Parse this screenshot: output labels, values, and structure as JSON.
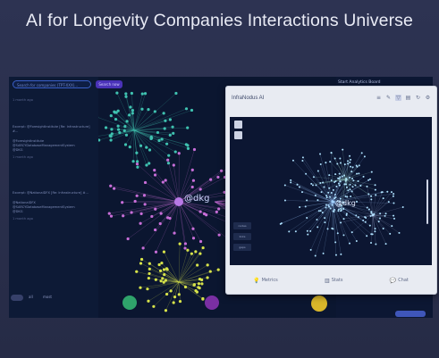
{
  "page": {
    "title": "AI for Longevity Companies Interactions Universe"
  },
  "app": {
    "search_placeholder": "Search for companies (TPT-XXX)...",
    "search_button": "Search now",
    "feed_items": [
      {
        "time": "1 month ago",
        "text": "Excerpt: @ForesightInstitute [Re: Infrastructure] #...",
        "mentions": [
          "@ForesightInstitute",
          "@SARCYDatabaseManagementSystem",
          "@DKG"
        ],
        "ago": "1 month ago"
      },
      {
        "time": "",
        "text": "Excerpt: @NationalDFX [Re: Infrastructure] #...",
        "mentions": [
          "@NationalDFX",
          "@SARCYDatabaseManagementSystem",
          "@DKG"
        ],
        "ago": "1 month ago"
      }
    ],
    "bottom_labels": [
      "all",
      "most"
    ],
    "right_header": "Start Analytics Board",
    "right_bottom_text": "How to leverage for longevity R&D coordination…",
    "center_node_label": "@dkg",
    "modal": {
      "title": "InfraNodus AI",
      "footer": {
        "metrics": "Metrics",
        "stats": "Stats",
        "chat": "Chat"
      },
      "legend_items": [
        "nodes",
        "links",
        "gaps"
      ],
      "center_label": "@dkg"
    }
  },
  "colors": {
    "background": "#2a2f4a",
    "screenshot_bg": "#0b1630",
    "accent": "#4a32b8",
    "node_pink": "#c86ed8",
    "node_teal": "#3fc2b0",
    "node_yellow": "#d7e34a"
  }
}
